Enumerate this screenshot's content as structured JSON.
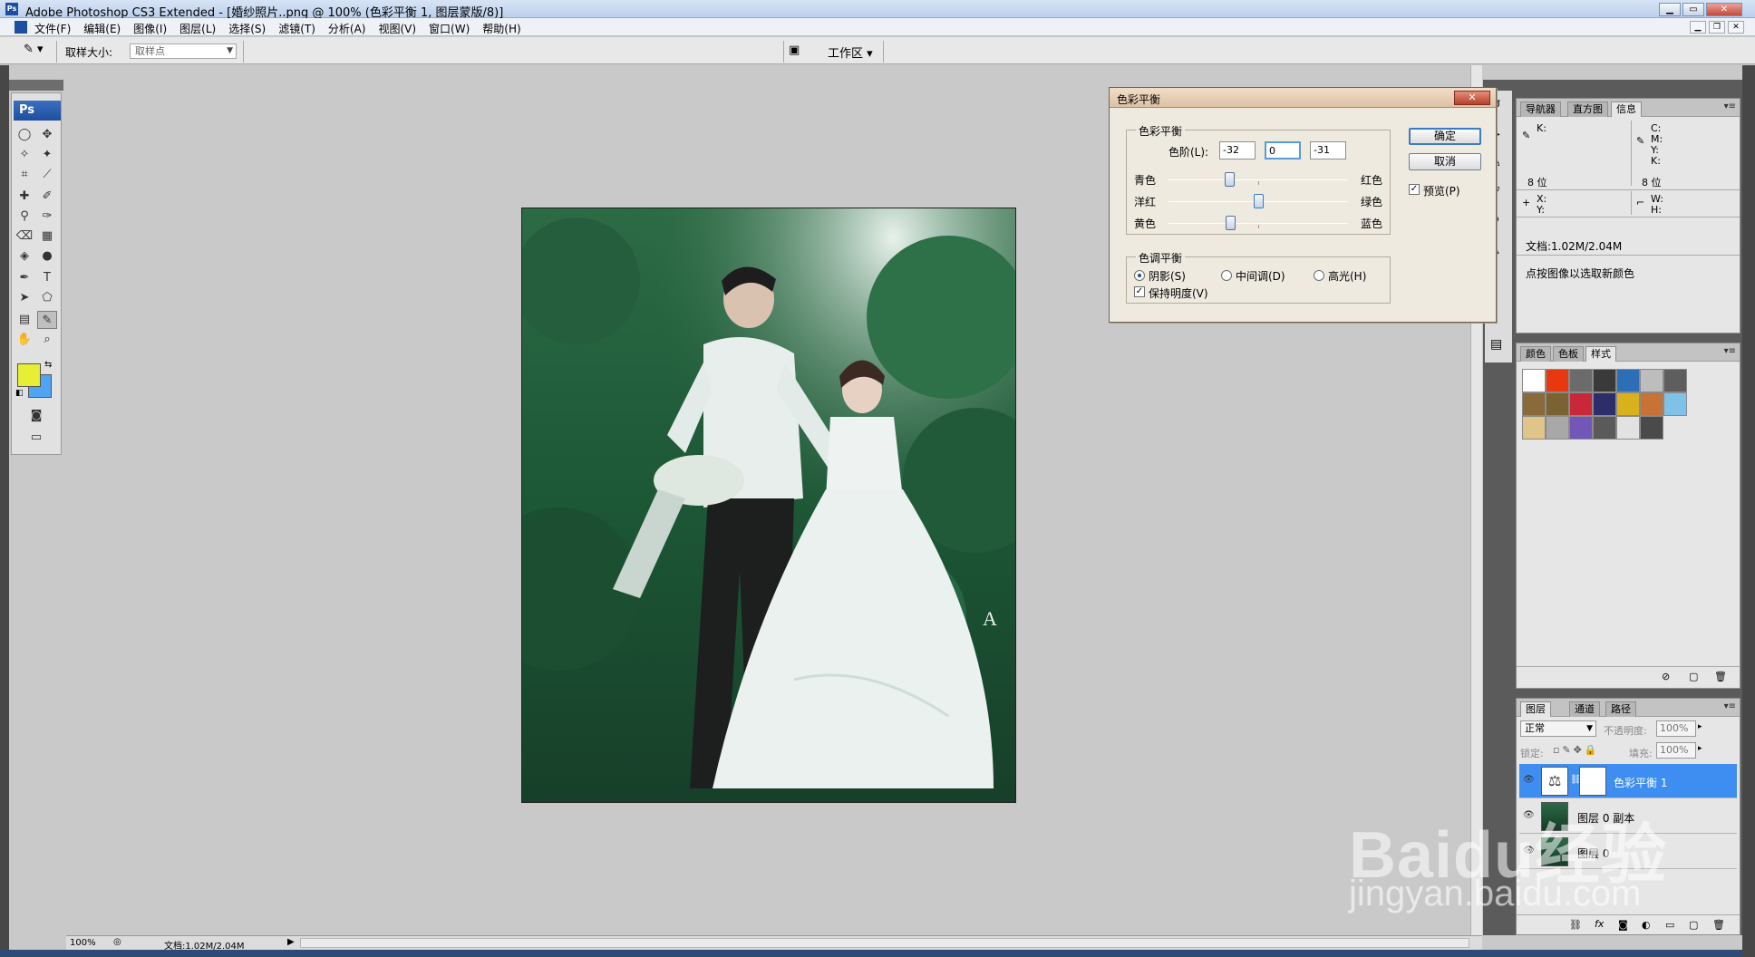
{
  "window": {
    "title": "Adobe Photoshop CS3 Extended - [婚纱照片..png @ 100% (色彩平衡 1, 图层蒙版/8)]",
    "app_badge": "Ps"
  },
  "menu": [
    "文件(F)",
    "编辑(E)",
    "图像(I)",
    "图层(L)",
    "选择(S)",
    "滤镜(T)",
    "分析(A)",
    "视图(V)",
    "窗口(W)",
    "帮助(H)"
  ],
  "options": {
    "sample_size_label": "取样大小:",
    "sample_size_value": "取样点",
    "workspace_label": "工作区 ▾"
  },
  "toolbox": {
    "badge": "Ps",
    "foreground_color": "#e8ee34",
    "background_color": "#4fa5f4"
  },
  "statusbar": {
    "zoom": "100%",
    "doc_size": "文档:1.02M/2.04M"
  },
  "dialog": {
    "title": "色彩平衡",
    "close_label": "✕",
    "color_balance_group": "色彩平衡",
    "levels_label": "色阶(L):",
    "levels": [
      "-32",
      "0",
      "-31"
    ],
    "sliders": [
      {
        "left": "青色",
        "right": "红色",
        "value": -32
      },
      {
        "left": "洋红",
        "right": "绿色",
        "value": 0
      },
      {
        "left": "黄色",
        "right": "蓝色",
        "value": -31
      }
    ],
    "tone_group": "色调平衡",
    "tones": [
      "阴影(S)",
      "中间调(D)",
      "高光(H)"
    ],
    "selected_tone": "阴影(S)",
    "preserve_luminosity": "保持明度(V)",
    "ok": "确定",
    "cancel": "取消",
    "preview": "预览(P)"
  },
  "info_panel": {
    "tabs": [
      "导航器",
      "直方图",
      "信息"
    ],
    "active_tab": "信息",
    "k_label": "K:",
    "c_label": "C:",
    "m_label": "M:",
    "y_label": "Y:",
    "k2_label": "K:",
    "bits_left": "8 位",
    "bits_right": "8 位",
    "x_label": "X:",
    "y2_label": "Y:",
    "w_label": "W:",
    "h_label": "H:",
    "doc": "文档:1.02M/2.04M",
    "hint": "点按图像以选取新颜色"
  },
  "styles_panel": {
    "tabs": [
      "颜色",
      "色板",
      "样式"
    ],
    "active_tab": "样式",
    "swatches": [
      "#ffffff",
      "#e8380f",
      "#6b6b6b",
      "#3a3a3a",
      "#2c6fb7",
      "#bdbdbd",
      "#5e5e5e",
      "#8a6a3a",
      "#7a6232",
      "#c8283a",
      "#2d2d6a",
      "#d8b21c",
      "#c87236",
      "#7fc2e8",
      "#e0c58a",
      "#a8a8a8",
      "#7256b8",
      "#5a5a5a",
      "#e2e2e2",
      "#4a4a4a"
    ]
  },
  "layers_panel": {
    "tabs": [
      "图层",
      "通道",
      "路径"
    ],
    "active_tab": "图层",
    "blend_mode": "正常",
    "opacity_label": "不透明度:",
    "opacity": "100%",
    "lock_label": "锁定:",
    "fill_label": "填充:",
    "fill": "100%",
    "layers": [
      "色彩平衡 1",
      "图层 0 副本",
      "图层 0"
    ],
    "selected_layer": "色彩平衡 1"
  },
  "watermark": {
    "logo": "Baidu经验",
    "url": "jingyan.baidu.com"
  }
}
